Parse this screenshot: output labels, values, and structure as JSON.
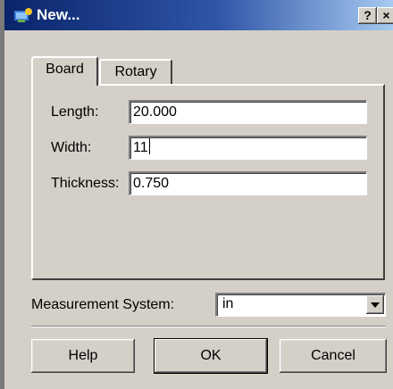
{
  "window": {
    "title": "New...",
    "help_btn": "?",
    "close_btn": "×"
  },
  "tabs": [
    {
      "label": "Board"
    },
    {
      "label": "Rotary"
    }
  ],
  "board": {
    "length": {
      "label": "Length:",
      "value": "20.000"
    },
    "width": {
      "label": "Width:",
      "value": "11"
    },
    "thickness": {
      "label": "Thickness:",
      "value": "0.750"
    }
  },
  "measurement": {
    "label": "Measurement System:",
    "value": "in"
  },
  "buttons": {
    "help": "Help",
    "ok": "OK",
    "cancel": "Cancel"
  },
  "icons": {
    "title": "app-icon",
    "dropdown": "chevron-down-icon"
  }
}
